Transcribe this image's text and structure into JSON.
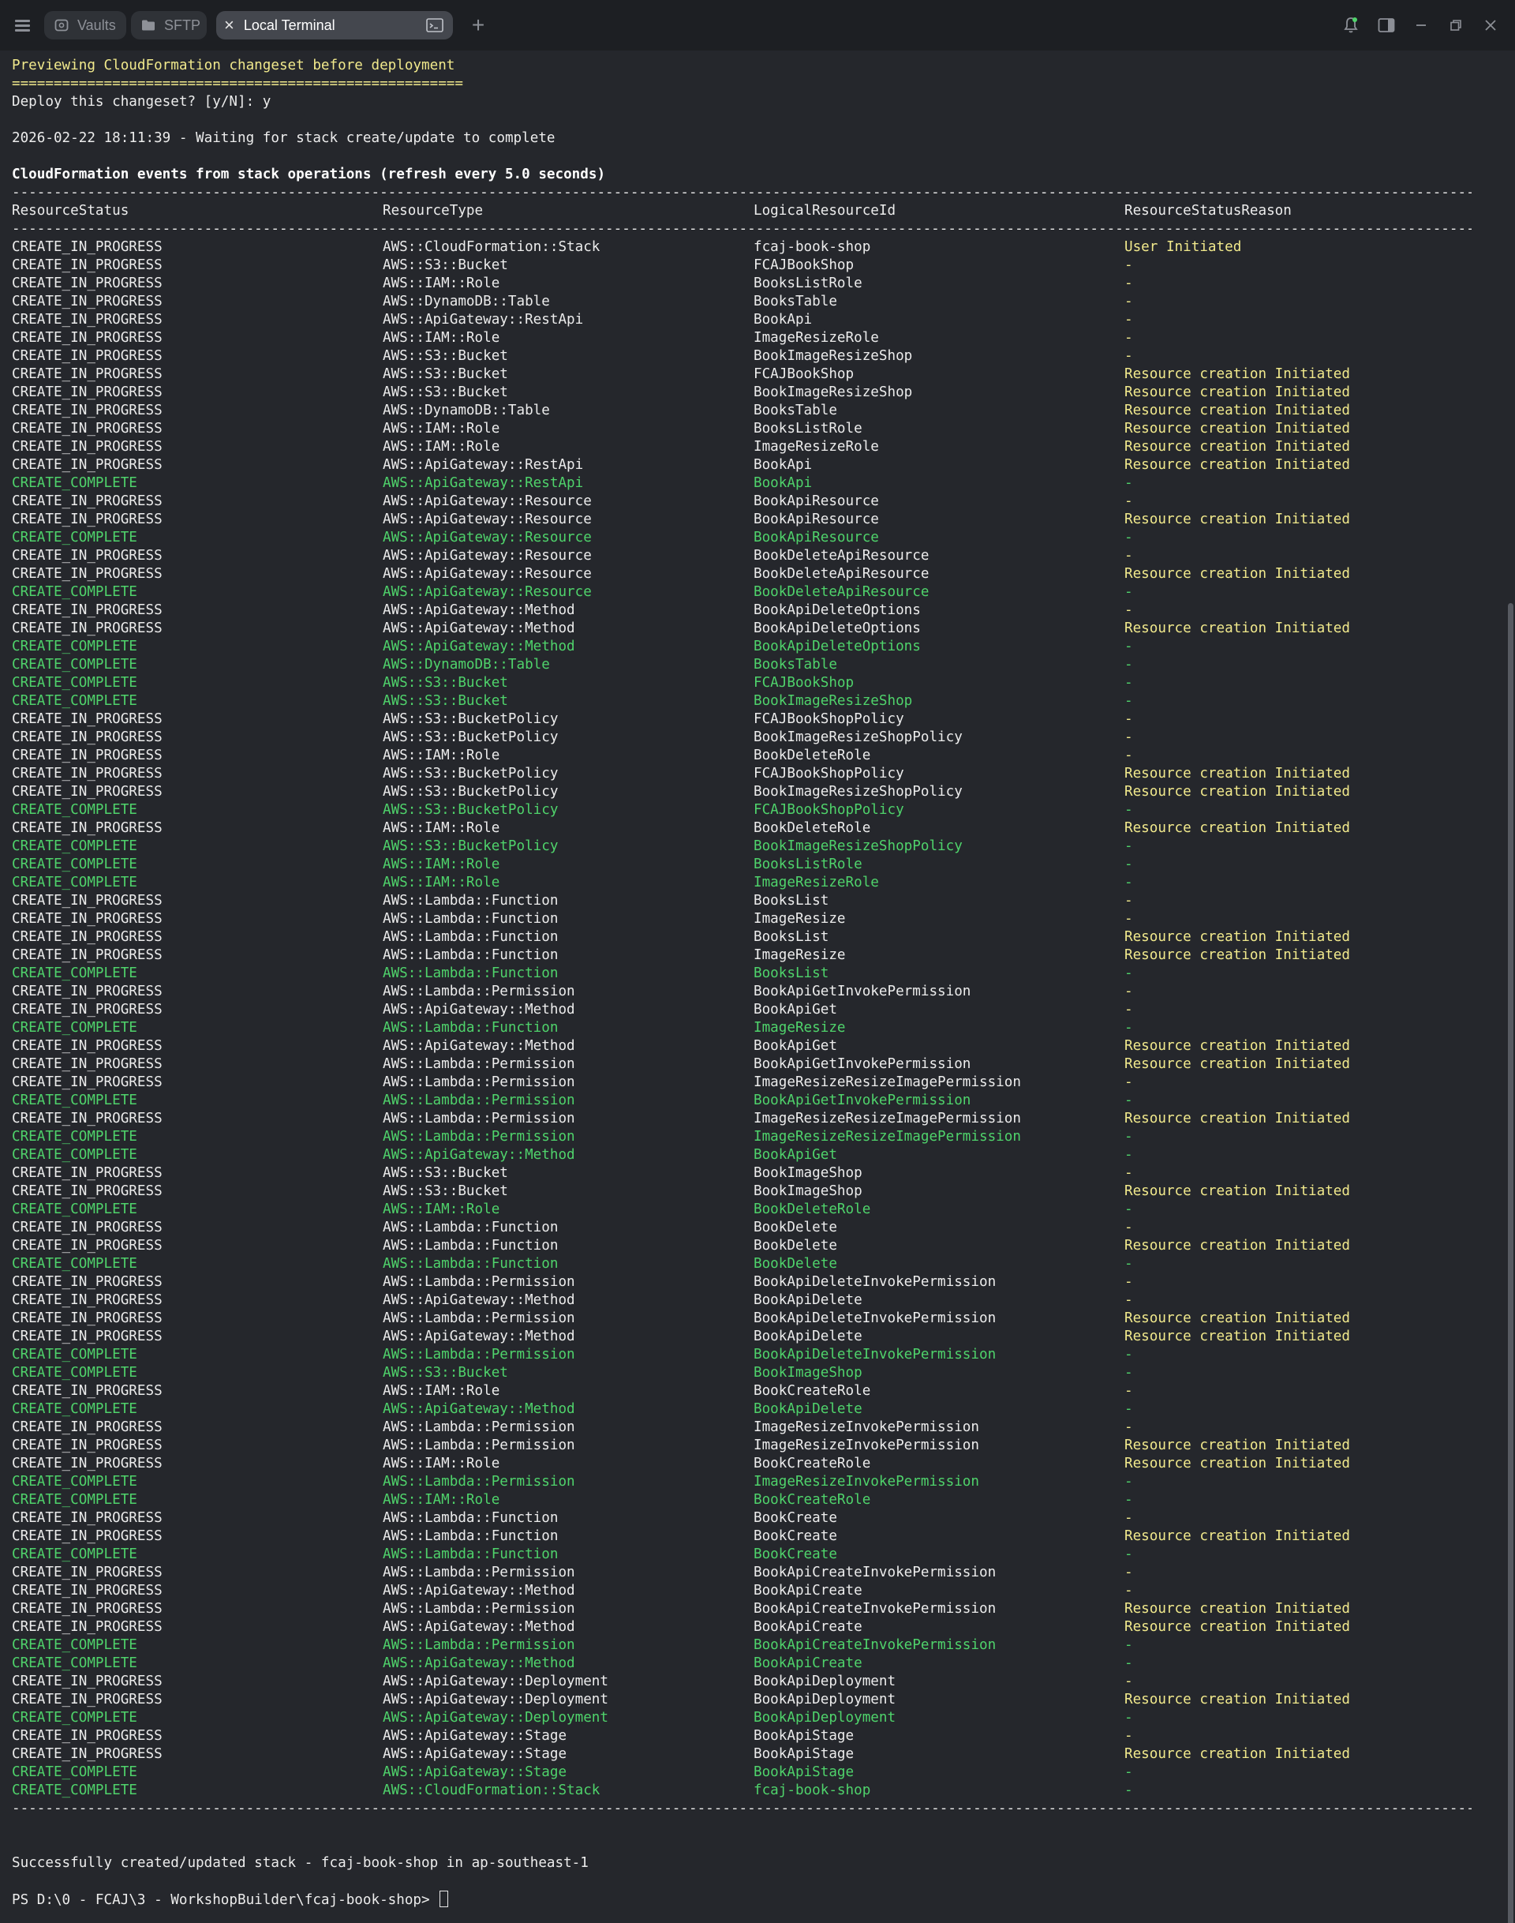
{
  "titlebar": {
    "tabs": [
      {
        "label": "Vaults",
        "icon": "vault-icon"
      },
      {
        "label": "SFTP",
        "icon": "folder-icon"
      },
      {
        "label": "Local Terminal",
        "icon": "close-icon",
        "active": true
      }
    ],
    "new_tab_symbol": "+"
  },
  "terminal": {
    "intro": [
      {
        "text": "Previewing CloudFormation changeset before deployment",
        "color": "yellow"
      },
      {
        "text": "======================================================",
        "color": "yellow"
      },
      {
        "text": "Deploy this changeset? [y/N]: y",
        "color": "white"
      },
      {
        "text": "",
        "color": "white"
      },
      {
        "text": "2026-02-22 18:11:39 - Waiting for stack create/update to complete",
        "color": "white"
      },
      {
        "text": "",
        "color": "white"
      },
      {
        "text": "CloudFormation events from stack operations (refresh every 5.0 seconds)",
        "color": "bold"
      }
    ],
    "headers": [
      "ResourceStatus",
      "ResourceType",
      "LogicalResourceId",
      "ResourceStatusReason"
    ],
    "events": [
      [
        "CREATE_IN_PROGRESS",
        "AWS::CloudFormation::Stack",
        "fcaj-book-shop",
        "User Initiated"
      ],
      [
        "CREATE_IN_PROGRESS",
        "AWS::S3::Bucket",
        "FCAJBookShop",
        "-"
      ],
      [
        "CREATE_IN_PROGRESS",
        "AWS::IAM::Role",
        "BooksListRole",
        "-"
      ],
      [
        "CREATE_IN_PROGRESS",
        "AWS::DynamoDB::Table",
        "BooksTable",
        "-"
      ],
      [
        "CREATE_IN_PROGRESS",
        "AWS::ApiGateway::RestApi",
        "BookApi",
        "-"
      ],
      [
        "CREATE_IN_PROGRESS",
        "AWS::IAM::Role",
        "ImageResizeRole",
        "-"
      ],
      [
        "CREATE_IN_PROGRESS",
        "AWS::S3::Bucket",
        "BookImageResizeShop",
        "-"
      ],
      [
        "CREATE_IN_PROGRESS",
        "AWS::S3::Bucket",
        "FCAJBookShop",
        "Resource creation Initiated"
      ],
      [
        "CREATE_IN_PROGRESS",
        "AWS::S3::Bucket",
        "BookImageResizeShop",
        "Resource creation Initiated"
      ],
      [
        "CREATE_IN_PROGRESS",
        "AWS::DynamoDB::Table",
        "BooksTable",
        "Resource creation Initiated"
      ],
      [
        "CREATE_IN_PROGRESS",
        "AWS::IAM::Role",
        "BooksListRole",
        "Resource creation Initiated"
      ],
      [
        "CREATE_IN_PROGRESS",
        "AWS::IAM::Role",
        "ImageResizeRole",
        "Resource creation Initiated"
      ],
      [
        "CREATE_IN_PROGRESS",
        "AWS::ApiGateway::RestApi",
        "BookApi",
        "Resource creation Initiated"
      ],
      [
        "CREATE_COMPLETE",
        "AWS::ApiGateway::RestApi",
        "BookApi",
        "-"
      ],
      [
        "CREATE_IN_PROGRESS",
        "AWS::ApiGateway::Resource",
        "BookApiResource",
        "-"
      ],
      [
        "CREATE_IN_PROGRESS",
        "AWS::ApiGateway::Resource",
        "BookApiResource",
        "Resource creation Initiated"
      ],
      [
        "CREATE_COMPLETE",
        "AWS::ApiGateway::Resource",
        "BookApiResource",
        "-"
      ],
      [
        "CREATE_IN_PROGRESS",
        "AWS::ApiGateway::Resource",
        "BookDeleteApiResource",
        "-"
      ],
      [
        "CREATE_IN_PROGRESS",
        "AWS::ApiGateway::Resource",
        "BookDeleteApiResource",
        "Resource creation Initiated"
      ],
      [
        "CREATE_COMPLETE",
        "AWS::ApiGateway::Resource",
        "BookDeleteApiResource",
        "-"
      ],
      [
        "CREATE_IN_PROGRESS",
        "AWS::ApiGateway::Method",
        "BookApiDeleteOptions",
        "-"
      ],
      [
        "CREATE_IN_PROGRESS",
        "AWS::ApiGateway::Method",
        "BookApiDeleteOptions",
        "Resource creation Initiated"
      ],
      [
        "CREATE_COMPLETE",
        "AWS::ApiGateway::Method",
        "BookApiDeleteOptions",
        "-"
      ],
      [
        "CREATE_COMPLETE",
        "AWS::DynamoDB::Table",
        "BooksTable",
        "-"
      ],
      [
        "CREATE_COMPLETE",
        "AWS::S3::Bucket",
        "FCAJBookShop",
        "-"
      ],
      [
        "CREATE_COMPLETE",
        "AWS::S3::Bucket",
        "BookImageResizeShop",
        "-"
      ],
      [
        "CREATE_IN_PROGRESS",
        "AWS::S3::BucketPolicy",
        "FCAJBookShopPolicy",
        "-"
      ],
      [
        "CREATE_IN_PROGRESS",
        "AWS::S3::BucketPolicy",
        "BookImageResizeShopPolicy",
        "-"
      ],
      [
        "CREATE_IN_PROGRESS",
        "AWS::IAM::Role",
        "BookDeleteRole",
        "-"
      ],
      [
        "CREATE_IN_PROGRESS",
        "AWS::S3::BucketPolicy",
        "FCAJBookShopPolicy",
        "Resource creation Initiated"
      ],
      [
        "CREATE_IN_PROGRESS",
        "AWS::S3::BucketPolicy",
        "BookImageResizeShopPolicy",
        "Resource creation Initiated"
      ],
      [
        "CREATE_COMPLETE",
        "AWS::S3::BucketPolicy",
        "FCAJBookShopPolicy",
        "-"
      ],
      [
        "CREATE_IN_PROGRESS",
        "AWS::IAM::Role",
        "BookDeleteRole",
        "Resource creation Initiated"
      ],
      [
        "CREATE_COMPLETE",
        "AWS::S3::BucketPolicy",
        "BookImageResizeShopPolicy",
        "-"
      ],
      [
        "CREATE_COMPLETE",
        "AWS::IAM::Role",
        "BooksListRole",
        "-"
      ],
      [
        "CREATE_COMPLETE",
        "AWS::IAM::Role",
        "ImageResizeRole",
        "-"
      ],
      [
        "CREATE_IN_PROGRESS",
        "AWS::Lambda::Function",
        "BooksList",
        "-"
      ],
      [
        "CREATE_IN_PROGRESS",
        "AWS::Lambda::Function",
        "ImageResize",
        "-"
      ],
      [
        "CREATE_IN_PROGRESS",
        "AWS::Lambda::Function",
        "BooksList",
        "Resource creation Initiated"
      ],
      [
        "CREATE_IN_PROGRESS",
        "AWS::Lambda::Function",
        "ImageResize",
        "Resource creation Initiated"
      ],
      [
        "CREATE_COMPLETE",
        "AWS::Lambda::Function",
        "BooksList",
        "-"
      ],
      [
        "CREATE_IN_PROGRESS",
        "AWS::Lambda::Permission",
        "BookApiGetInvokePermission",
        "-"
      ],
      [
        "CREATE_IN_PROGRESS",
        "AWS::ApiGateway::Method",
        "BookApiGet",
        "-"
      ],
      [
        "CREATE_COMPLETE",
        "AWS::Lambda::Function",
        "ImageResize",
        "-"
      ],
      [
        "CREATE_IN_PROGRESS",
        "AWS::ApiGateway::Method",
        "BookApiGet",
        "Resource creation Initiated"
      ],
      [
        "CREATE_IN_PROGRESS",
        "AWS::Lambda::Permission",
        "BookApiGetInvokePermission",
        "Resource creation Initiated"
      ],
      [
        "CREATE_IN_PROGRESS",
        "AWS::Lambda::Permission",
        "ImageResizeResizeImagePermission",
        "-"
      ],
      [
        "CREATE_COMPLETE",
        "AWS::Lambda::Permission",
        "BookApiGetInvokePermission",
        "-"
      ],
      [
        "CREATE_IN_PROGRESS",
        "AWS::Lambda::Permission",
        "ImageResizeResizeImagePermission",
        "Resource creation Initiated"
      ],
      [
        "CREATE_COMPLETE",
        "AWS::Lambda::Permission",
        "ImageResizeResizeImagePermission",
        "-"
      ],
      [
        "CREATE_COMPLETE",
        "AWS::ApiGateway::Method",
        "BookApiGet",
        "-"
      ],
      [
        "CREATE_IN_PROGRESS",
        "AWS::S3::Bucket",
        "BookImageShop",
        "-"
      ],
      [
        "CREATE_IN_PROGRESS",
        "AWS::S3::Bucket",
        "BookImageShop",
        "Resource creation Initiated"
      ],
      [
        "CREATE_COMPLETE",
        "AWS::IAM::Role",
        "BookDeleteRole",
        "-"
      ],
      [
        "CREATE_IN_PROGRESS",
        "AWS::Lambda::Function",
        "BookDelete",
        "-"
      ],
      [
        "CREATE_IN_PROGRESS",
        "AWS::Lambda::Function",
        "BookDelete",
        "Resource creation Initiated"
      ],
      [
        "CREATE_COMPLETE",
        "AWS::Lambda::Function",
        "BookDelete",
        "-"
      ],
      [
        "CREATE_IN_PROGRESS",
        "AWS::Lambda::Permission",
        "BookApiDeleteInvokePermission",
        "-"
      ],
      [
        "CREATE_IN_PROGRESS",
        "AWS::ApiGateway::Method",
        "BookApiDelete",
        "-"
      ],
      [
        "CREATE_IN_PROGRESS",
        "AWS::Lambda::Permission",
        "BookApiDeleteInvokePermission",
        "Resource creation Initiated"
      ],
      [
        "CREATE_IN_PROGRESS",
        "AWS::ApiGateway::Method",
        "BookApiDelete",
        "Resource creation Initiated"
      ],
      [
        "CREATE_COMPLETE",
        "AWS::Lambda::Permission",
        "BookApiDeleteInvokePermission",
        "-"
      ],
      [
        "CREATE_COMPLETE",
        "AWS::S3::Bucket",
        "BookImageShop",
        "-"
      ],
      [
        "CREATE_IN_PROGRESS",
        "AWS::IAM::Role",
        "BookCreateRole",
        "-"
      ],
      [
        "CREATE_COMPLETE",
        "AWS::ApiGateway::Method",
        "BookApiDelete",
        "-"
      ],
      [
        "CREATE_IN_PROGRESS",
        "AWS::Lambda::Permission",
        "ImageResizeInvokePermission",
        "-"
      ],
      [
        "CREATE_IN_PROGRESS",
        "AWS::Lambda::Permission",
        "ImageResizeInvokePermission",
        "Resource creation Initiated"
      ],
      [
        "CREATE_IN_PROGRESS",
        "AWS::IAM::Role",
        "BookCreateRole",
        "Resource creation Initiated"
      ],
      [
        "CREATE_COMPLETE",
        "AWS::Lambda::Permission",
        "ImageResizeInvokePermission",
        "-"
      ],
      [
        "CREATE_COMPLETE",
        "AWS::IAM::Role",
        "BookCreateRole",
        "-"
      ],
      [
        "CREATE_IN_PROGRESS",
        "AWS::Lambda::Function",
        "BookCreate",
        "-"
      ],
      [
        "CREATE_IN_PROGRESS",
        "AWS::Lambda::Function",
        "BookCreate",
        "Resource creation Initiated"
      ],
      [
        "CREATE_COMPLETE",
        "AWS::Lambda::Function",
        "BookCreate",
        "-"
      ],
      [
        "CREATE_IN_PROGRESS",
        "AWS::Lambda::Permission",
        "BookApiCreateInvokePermission",
        "-"
      ],
      [
        "CREATE_IN_PROGRESS",
        "AWS::ApiGateway::Method",
        "BookApiCreate",
        "-"
      ],
      [
        "CREATE_IN_PROGRESS",
        "AWS::Lambda::Permission",
        "BookApiCreateInvokePermission",
        "Resource creation Initiated"
      ],
      [
        "CREATE_IN_PROGRESS",
        "AWS::ApiGateway::Method",
        "BookApiCreate",
        "Resource creation Initiated"
      ],
      [
        "CREATE_COMPLETE",
        "AWS::Lambda::Permission",
        "BookApiCreateInvokePermission",
        "-"
      ],
      [
        "CREATE_COMPLETE",
        "AWS::ApiGateway::Method",
        "BookApiCreate",
        "-"
      ],
      [
        "CREATE_IN_PROGRESS",
        "AWS::ApiGateway::Deployment",
        "BookApiDeployment",
        "-"
      ],
      [
        "CREATE_IN_PROGRESS",
        "AWS::ApiGateway::Deployment",
        "BookApiDeployment",
        "Resource creation Initiated"
      ],
      [
        "CREATE_COMPLETE",
        "AWS::ApiGateway::Deployment",
        "BookApiDeployment",
        "-"
      ],
      [
        "CREATE_IN_PROGRESS",
        "AWS::ApiGateway::Stage",
        "BookApiStage",
        "-"
      ],
      [
        "CREATE_IN_PROGRESS",
        "AWS::ApiGateway::Stage",
        "BookApiStage",
        "Resource creation Initiated"
      ],
      [
        "CREATE_COMPLETE",
        "AWS::ApiGateway::Stage",
        "BookApiStage",
        "-"
      ],
      [
        "CREATE_COMPLETE",
        "AWS::CloudFormation::Stack",
        "fcaj-book-shop",
        "-"
      ]
    ],
    "rule_char": "-",
    "success_message": "Successfully created/updated stack - fcaj-book-shop in ap-southeast-1",
    "prompt": "PS D:\\0 - FCAJ\\3 - WorkshopBuilder\\fcaj-book-shop> ",
    "colors": {
      "yellow": "#f1e98c",
      "green": "#4fd36b",
      "background": "#25272c",
      "titlebar": "#1d1f23"
    }
  }
}
